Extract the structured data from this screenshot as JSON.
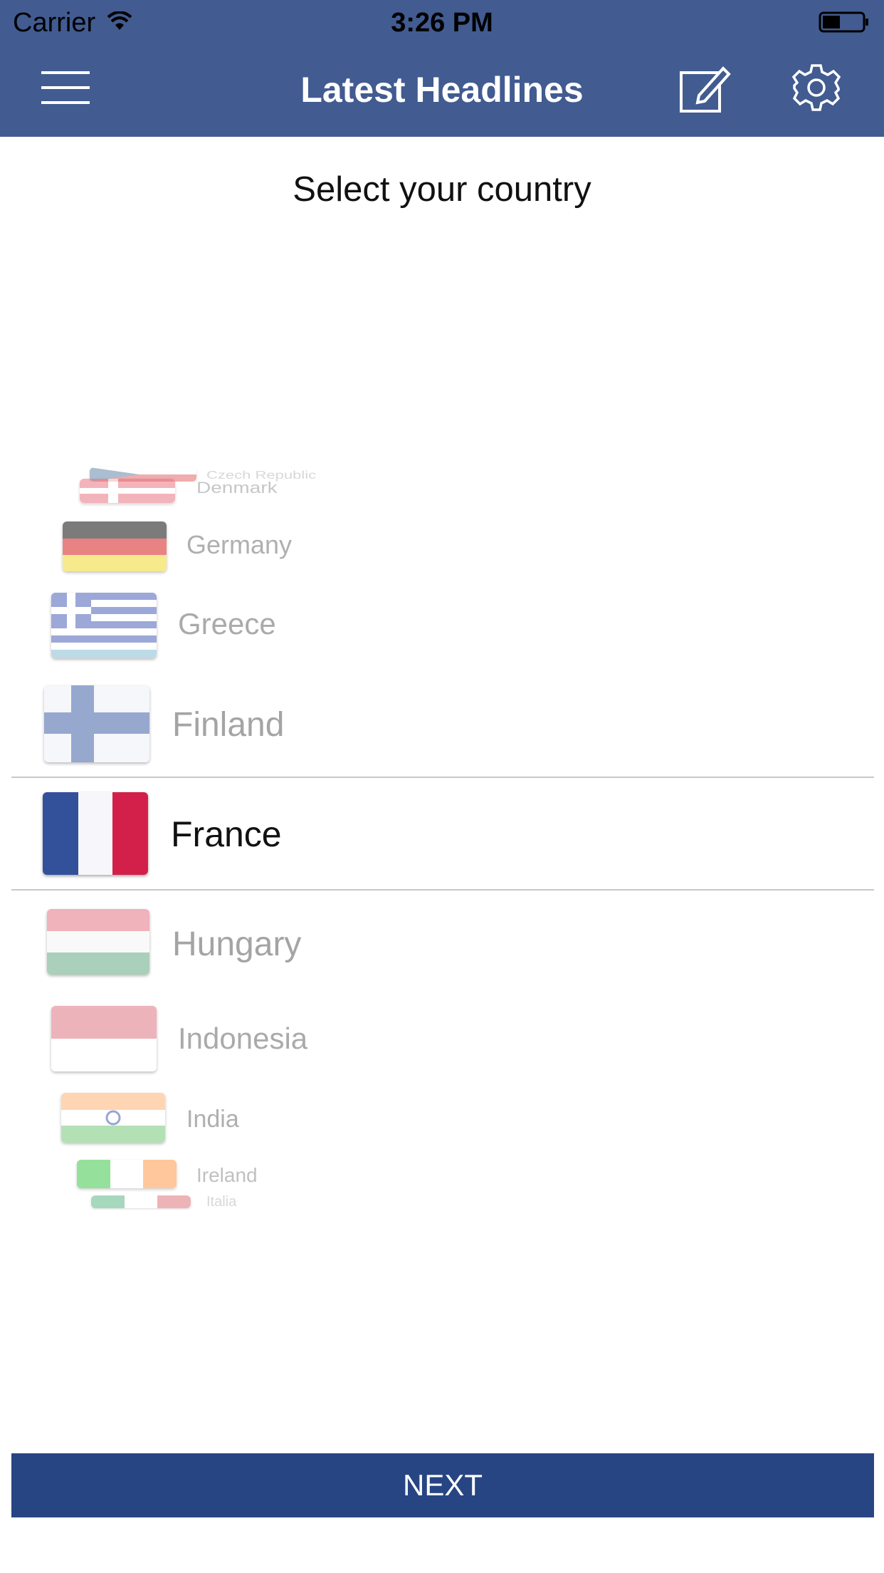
{
  "status_bar": {
    "carrier": "Carrier",
    "time": "3:26 PM"
  },
  "header": {
    "title": "Latest Headlines"
  },
  "page": {
    "prompt": "Select your country"
  },
  "picker": {
    "items": [
      {
        "label": "Czech Republic",
        "flag": "czech-flag-icon"
      },
      {
        "label": "Denmark",
        "flag": "denmark-flag-icon"
      },
      {
        "label": "Germany",
        "flag": "germany-flag-icon"
      },
      {
        "label": "Greece",
        "flag": "greece-flag-icon"
      },
      {
        "label": "Finland",
        "flag": "finland-flag-icon"
      },
      {
        "label": "France",
        "flag": "france-flag-icon",
        "selected": true
      },
      {
        "label": "Hungary",
        "flag": "hungary-flag-icon"
      },
      {
        "label": "Indonesia",
        "flag": "indonesia-flag-icon"
      },
      {
        "label": "India",
        "flag": "india-flag-icon"
      },
      {
        "label": "Ireland",
        "flag": "ireland-flag-icon"
      },
      {
        "label": "Italia",
        "flag": "italy-flag-icon"
      }
    ]
  },
  "actions": {
    "next_label": "NEXT"
  },
  "colors": {
    "header_bg": "#425b91",
    "button_bg": "#284583",
    "text_selected": "#111111",
    "text_faded": "#8e8e8e"
  }
}
